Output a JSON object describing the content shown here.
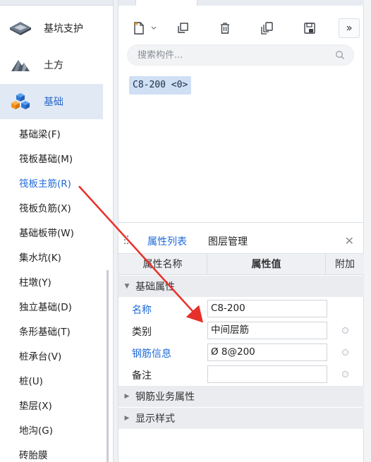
{
  "nav": {
    "categories": [
      {
        "label": "基坑支护",
        "icon": "pit-support-icon"
      },
      {
        "label": "土方",
        "icon": "earthwork-icon"
      },
      {
        "label": "基础",
        "icon": "foundation-icon"
      }
    ],
    "items": [
      "基础梁(F)",
      "筏板基础(M)",
      "筏板主筋(R)",
      "筏板负筋(X)",
      "基础板带(W)",
      "集水坑(K)",
      "柱墩(Y)",
      "独立基础(D)",
      "条形基础(T)",
      "桩承台(V)",
      "桩(U)",
      "垫层(X)",
      "地沟(G)",
      "砖胎膜"
    ],
    "active_item_index": 2
  },
  "component_list": {
    "search_placeholder": "搜索构件...",
    "component": "C8-200 <0>"
  },
  "properties": {
    "tabs": [
      "属性列表",
      "图层管理"
    ],
    "columns": [
      "属性名称",
      "属性值",
      "附加"
    ],
    "group_basic": "基础属性",
    "rows": [
      {
        "name": "名称",
        "value": "C8-200"
      },
      {
        "name": "类别",
        "value": "中间层筋"
      },
      {
        "name": "钢筋信息",
        "value": "Ø 8@200"
      },
      {
        "name": "备注",
        "value": ""
      }
    ],
    "groups_collapsed": [
      "钢筋业务属性",
      "显示样式"
    ]
  },
  "colors": {
    "accent": "#1f6ad8",
    "arrow": "#e8302a",
    "chip": "#cfdff4"
  }
}
